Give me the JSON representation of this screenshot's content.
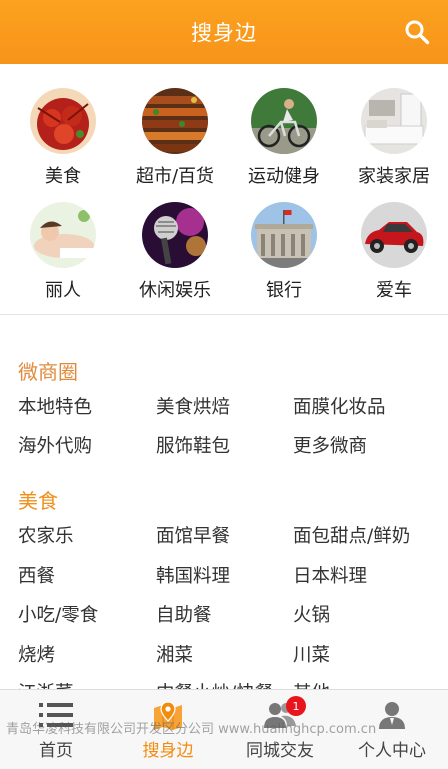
{
  "header": {
    "title": "搜身边"
  },
  "categories": [
    {
      "label": "美食",
      "icon": "crayfish-food-icon"
    },
    {
      "label": "超市/百货",
      "icon": "market-skewers-icon"
    },
    {
      "label": "运动健身",
      "icon": "cyclist-icon"
    },
    {
      "label": "家装家居",
      "icon": "bedroom-icon"
    },
    {
      "label": "丽人",
      "icon": "spa-woman-icon"
    },
    {
      "label": "休闲娱乐",
      "icon": "microphone-icon"
    },
    {
      "label": "银行",
      "icon": "bank-building-icon"
    },
    {
      "label": "爱车",
      "icon": "red-car-icon"
    }
  ],
  "sections": [
    {
      "title": "微商圈",
      "color": "#e08a3c",
      "links": [
        "本地特色",
        "美食烘焙",
        "面膜化妆品",
        "海外代购",
        "服饰鞋包",
        "更多微商"
      ]
    },
    {
      "title": "美食",
      "color": "#f0901a",
      "links": [
        "农家乐",
        "面馆早餐",
        "面包甜点/鲜奶",
        "西餐",
        "韩国料理",
        "日本料理",
        "小吃/零食",
        "自助餐",
        "火锅",
        "烧烤",
        "湘菜",
        "川菜",
        "江浙菜",
        "中餐小炒/快餐",
        "其他"
      ]
    }
  ],
  "tabbar": {
    "tabs": [
      {
        "label": "首页",
        "icon": "menu-lines-icon"
      },
      {
        "label": "搜身边",
        "icon": "map-pin-icon"
      },
      {
        "label": "同城交友",
        "icon": "friends-icon",
        "badge": "1"
      },
      {
        "label": "个人中心",
        "icon": "person-icon"
      }
    ],
    "active_color": "#f28c0e"
  },
  "watermark": "青岛华凌科技有限公司开发区分公司 www.hualinghcp.com.cn"
}
